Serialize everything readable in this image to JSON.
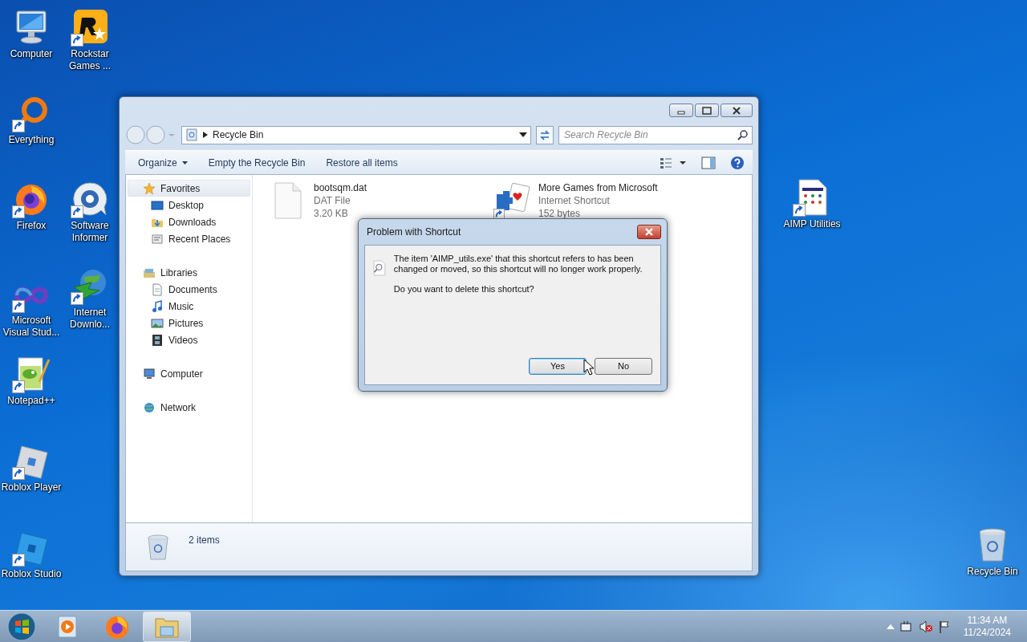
{
  "desktop_icons": [
    {
      "kind": "computer",
      "label": "Computer",
      "shortcut": false
    },
    {
      "kind": "rockstar",
      "label": "Rockstar Games ...",
      "shortcut": true
    },
    {
      "kind": "everything",
      "label": "Everything",
      "shortcut": true
    },
    {
      "kind": "firefox",
      "label": "Firefox",
      "shortcut": true
    },
    {
      "kind": "informer",
      "label": "Software Informer",
      "shortcut": true
    },
    {
      "kind": "vs",
      "label": "Microsoft Visual Stud...",
      "shortcut": true
    },
    {
      "kind": "idm",
      "label": "Internet Downlo...",
      "shortcut": true
    },
    {
      "kind": "notepad",
      "label": "Notepad++",
      "shortcut": true
    },
    {
      "kind": "roblox",
      "label": "Roblox Player",
      "shortcut": true
    },
    {
      "kind": "studio",
      "label": "Roblox Studio",
      "shortcut": true
    },
    {
      "kind": "aimp",
      "label": "AIMP Utilities",
      "shortcut": true
    },
    {
      "kind": "recycle",
      "label": "Recycle Bin",
      "shortcut": false
    }
  ],
  "explorer": {
    "address": "Recycle Bin",
    "search": {
      "placeholder": "Search Recycle Bin"
    },
    "commands": [
      {
        "kind": "menu",
        "label": "Organize"
      },
      {
        "kind": "plain",
        "label": "Empty the Recycle Bin"
      },
      {
        "kind": "plain",
        "label": "Restore all items"
      }
    ],
    "nav": [
      {
        "kind": "star",
        "label": "Favorites",
        "selected": true,
        "children": [
          {
            "kind": "desktop",
            "label": "Desktop",
            "selected": false
          },
          {
            "kind": "downloads",
            "label": "Downloads",
            "selected": false
          },
          {
            "kind": "recent",
            "label": "Recent Places",
            "selected": false
          }
        ]
      },
      {
        "kind": "library",
        "label": "Libraries",
        "selected": false,
        "children": [
          {
            "kind": "document",
            "label": "Documents",
            "selected": false
          },
          {
            "kind": "music",
            "label": "Music",
            "selected": false
          },
          {
            "kind": "pictures",
            "label": "Pictures",
            "selected": false
          },
          {
            "kind": "videos",
            "label": "Videos",
            "selected": false
          }
        ]
      },
      {
        "kind": "computer",
        "label": "Computer",
        "selected": false
      },
      {
        "kind": "network",
        "label": "Network",
        "selected": false
      }
    ],
    "files": [
      {
        "kind": "file",
        "name": "bootsqm.dat",
        "type": "DAT File",
        "size": "3.20 KB",
        "shortcut": false
      },
      {
        "kind": "games",
        "name": "More Games from Microsoft",
        "type": "Internet Shortcut",
        "size": "152 bytes",
        "shortcut": true
      }
    ],
    "status": "2 items"
  },
  "dialog": {
    "title": "Problem with Shortcut",
    "message": "The item 'AIMP_utils.exe' that this shortcut refers to has been changed or moved, so this shortcut will no longer work properly.",
    "question": "Do you want to delete this shortcut?",
    "buttons": [
      {
        "label": "Yes",
        "focused": true
      },
      {
        "label": "No",
        "focused": false
      }
    ]
  },
  "taskbar": {
    "items": [
      {
        "kind": "media",
        "selected": false
      },
      {
        "kind": "firefox",
        "selected": false
      },
      {
        "kind": "explorer",
        "selected": true
      }
    ],
    "time": "11:34 AM",
    "date": "11/24/2024"
  }
}
